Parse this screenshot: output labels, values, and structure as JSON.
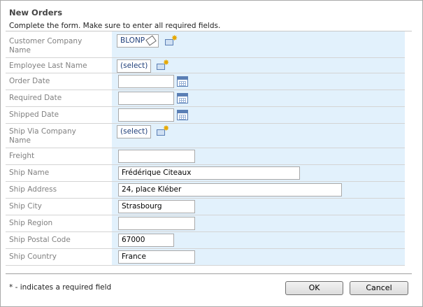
{
  "dialog": {
    "title": "New Orders",
    "description": "Complete the form. Make sure to enter all required fields."
  },
  "fields": {
    "customer_company_name": {
      "label": "Customer Company Name",
      "value": "BLONP"
    },
    "employee_last_name": {
      "label": "Employee Last Name",
      "value": "(select)"
    },
    "order_date": {
      "label": "Order Date",
      "value": ""
    },
    "required_date": {
      "label": "Required Date",
      "value": ""
    },
    "shipped_date": {
      "label": "Shipped Date",
      "value": ""
    },
    "ship_via_company_name": {
      "label": "Ship Via Company Name",
      "value": "(select)"
    },
    "freight": {
      "label": "Freight",
      "value": ""
    },
    "ship_name": {
      "label": "Ship Name",
      "value": "Frédérique Citeaux"
    },
    "ship_address": {
      "label": "Ship Address",
      "value": "24, place Kléber"
    },
    "ship_city": {
      "label": "Ship City",
      "value": "Strasbourg"
    },
    "ship_region": {
      "label": "Ship Region",
      "value": ""
    },
    "ship_postal_code": {
      "label": "Ship Postal Code",
      "value": "67000"
    },
    "ship_country": {
      "label": "Ship Country",
      "value": "France"
    }
  },
  "footer": {
    "required_note": "* - indicates a required field",
    "ok_label": "OK",
    "cancel_label": "Cancel"
  },
  "icons": {
    "calendar": "calendar-icon",
    "new_item": "new-item-icon",
    "clear": "eraser-icon"
  },
  "colors": {
    "value_column_bg": "#e2f1fc",
    "label_text": "#808080",
    "link_text": "#1f3f7a"
  }
}
